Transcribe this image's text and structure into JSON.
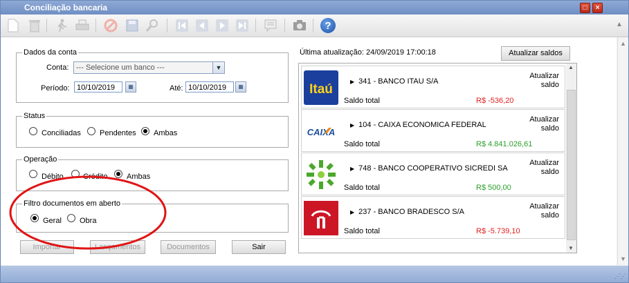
{
  "window": {
    "title": "Conciliação bancaria",
    "controls": [
      "□",
      "×"
    ]
  },
  "toolbar": {
    "help_glyph": "?"
  },
  "dados": {
    "legend": "Dados da conta",
    "conta_label": "Conta:",
    "conta_value": "--- Selecione um banco ---",
    "periodo_label": "Período:",
    "periodo_de": "10/10/2019",
    "ate_label": "Até:",
    "periodo_ate": "10/10/2019"
  },
  "status": {
    "legend": "Status",
    "options": [
      "Conciliadas",
      "Pendentes",
      "Ambas"
    ],
    "selected": "Ambas"
  },
  "operacao": {
    "legend": "Operação",
    "options": [
      "Débito",
      "Crédito",
      "Ambas"
    ],
    "selected": "Ambas"
  },
  "filtro": {
    "legend": "Filtro documentos em aberto",
    "options": [
      "Geral",
      "Obra"
    ],
    "selected": "Geral"
  },
  "buttons": {
    "importar": "Importar",
    "lancamentos": "Lançamentos",
    "documentos": "Documentos",
    "sair": "Sair"
  },
  "ultima_atualizacao": "Última atualização: 24/09/2019 17:00:18",
  "atualizar_saldos": "Atualizar saldos",
  "banks": [
    {
      "name": "341 - BANCO ITAU S/A",
      "saldo_label": "Saldo total",
      "saldo": "R$ -536,20",
      "saldo_color": "#e02020",
      "refresh": "Atualizar saldo",
      "logo_text": "Itaú",
      "logo": "itau-logo"
    },
    {
      "name": "104 - CAIXA ECONOMICA FEDERAL",
      "saldo_label": "Saldo total",
      "saldo": "R$ 4.841.026,61",
      "saldo_color": "#2aa02a",
      "refresh": "Atualizar saldo",
      "logo_text": "CAIXA",
      "logo": "caixa-logo"
    },
    {
      "name": "748 - BANCO COOPERATIVO SICREDI SA",
      "saldo_label": "Saldo total",
      "saldo": "R$ 500,00",
      "saldo_color": "#2aa02a",
      "refresh": "Atualizar saldo",
      "logo": "sicredi-logo"
    },
    {
      "name": "237 - BANCO BRADESCO S/A",
      "saldo_label": "Saldo total",
      "saldo": "R$ -5.739,10",
      "saldo_color": "#e02020",
      "refresh": "Atualizar saldo",
      "logo": "bradesco-logo"
    }
  ],
  "colors": {
    "accent": "#6f8fc4",
    "annotation": "#e01515",
    "negative": "#e02020",
    "positive": "#2aa02a"
  }
}
